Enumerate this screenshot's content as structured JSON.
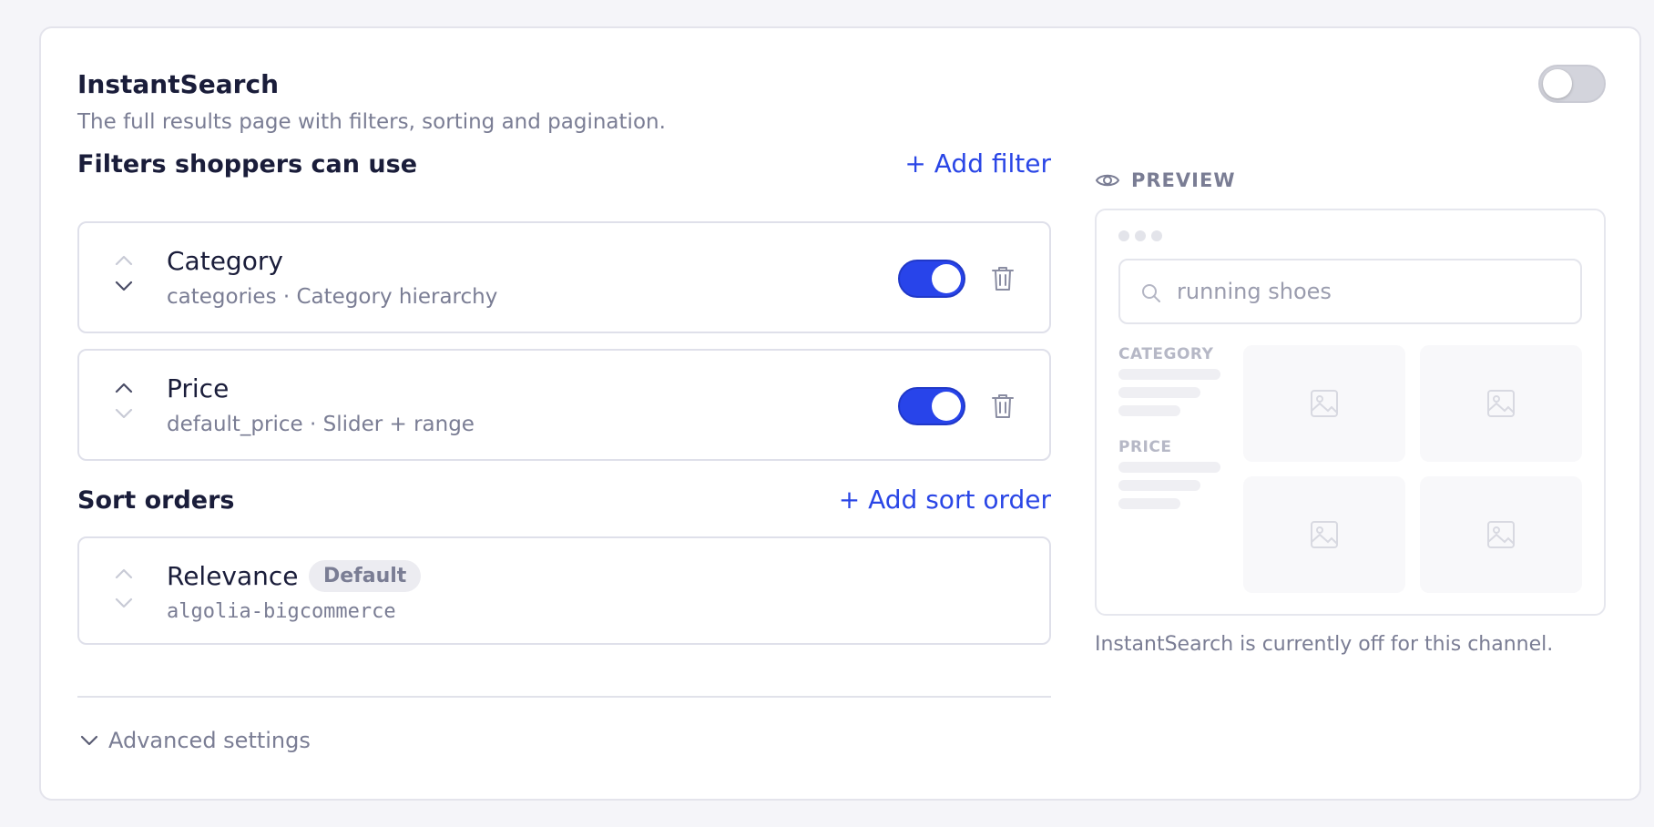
{
  "section": {
    "title": "InstantSearch",
    "description": "The full results page with filters, sorting and pagination.",
    "enabled": false
  },
  "filters": {
    "title": "Filters shoppers can use",
    "add_label": "+ Add filter",
    "items": [
      {
        "name": "Category",
        "meta": "categories · Category hierarchy",
        "enabled": true
      },
      {
        "name": "Price",
        "meta": "default_price · Slider + range",
        "enabled": true
      }
    ]
  },
  "sort": {
    "title": "Sort orders",
    "add_label": "+ Add sort order",
    "items": [
      {
        "name": "Relevance",
        "badge": "Default",
        "meta": "algolia-bigcommerce"
      }
    ]
  },
  "advanced": {
    "label": "Advanced settings"
  },
  "preview": {
    "label": "PREVIEW",
    "search_text": "running shoes",
    "facet_labels": [
      "CATEGORY",
      "PRICE"
    ],
    "status": "InstantSearch is currently off for this channel."
  },
  "colors": {
    "accent": "#2844ea",
    "text_primary": "#1a1d3a",
    "text_muted": "#7a7d94"
  }
}
